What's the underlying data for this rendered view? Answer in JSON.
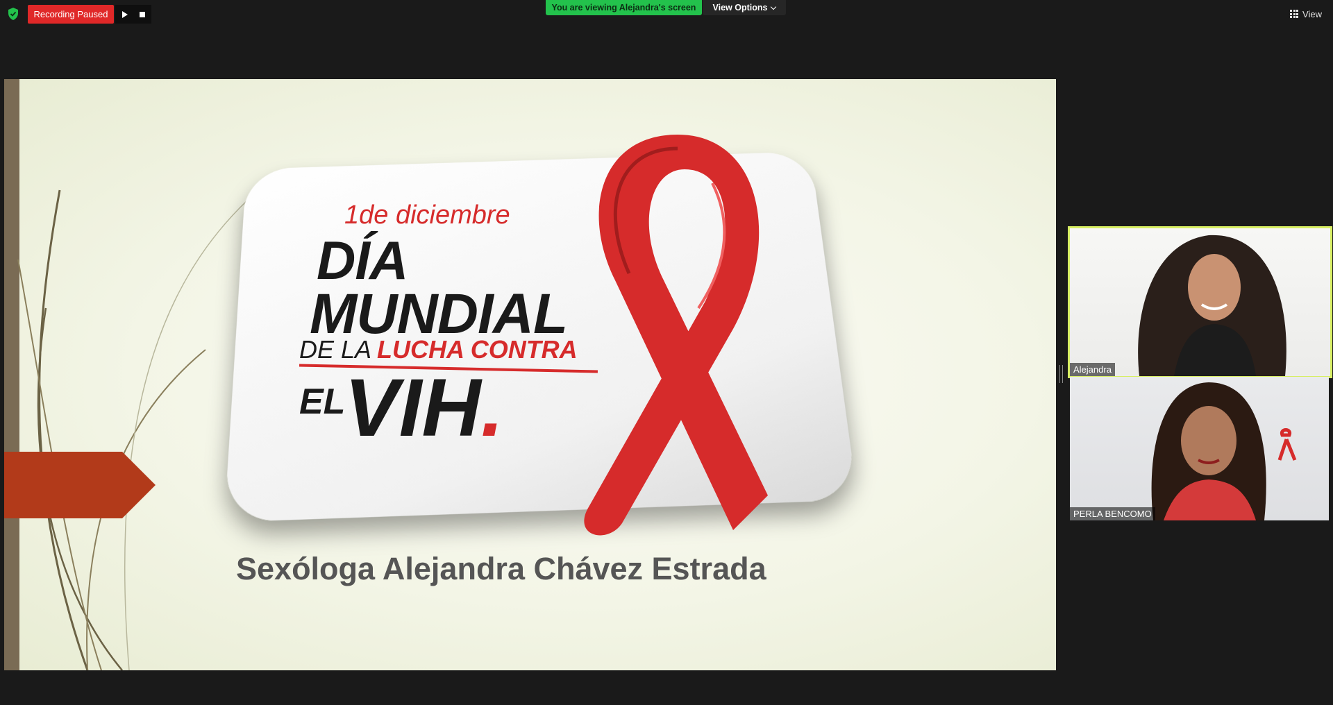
{
  "top_bar": {
    "recording_status": "Recording Paused",
    "viewing_banner": "You are viewing Alejandra's screen",
    "view_options_label": "View Options",
    "view_label": "View"
  },
  "shared_screen": {
    "badge_date": "1de diciembre",
    "badge_line1": "DÍA",
    "badge_line2": "MUNDIAL",
    "badge_line3_black": "DE LA",
    "badge_line3_red": "LUCHA CONTRA",
    "badge_line4_small": "EL",
    "badge_line4_big": "VIH",
    "badge_dot": ".",
    "subtitle": "Sexóloga Alejandra Chávez Estrada"
  },
  "participants": [
    {
      "name": "Alejandra",
      "active_speaker": true
    },
    {
      "name": "PERLA BENCOMO",
      "active_speaker": false
    }
  ],
  "colors": {
    "recording_red": "#e02828",
    "viewing_green": "#23c24c",
    "active_speaker_border": "#d7ee63",
    "ribbon_red": "#d62b2b",
    "slide_arrow": "#b23a1a"
  }
}
